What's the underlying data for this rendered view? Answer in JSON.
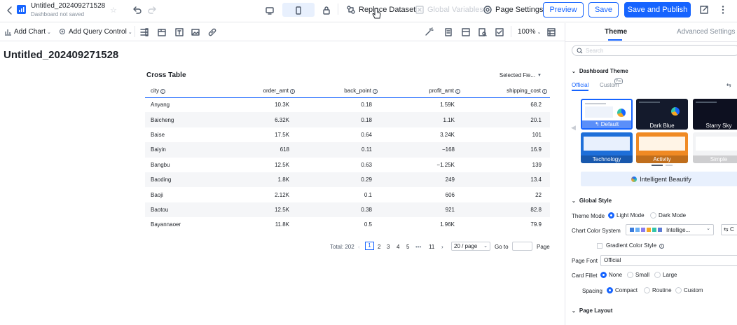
{
  "header": {
    "title": "Untitled_202409271528",
    "subtitle": "Dashboard not saved",
    "replace_dataset": "Replace Dataset",
    "global_variables": "Global Variables",
    "page_settings": "Page Settings",
    "preview": "Preview",
    "save": "Save",
    "save_publish": "Save and Publish"
  },
  "toolbar": {
    "add_chart": "Add Chart",
    "add_query_control": "Add Query Control",
    "zoom": "100%"
  },
  "canvas": {
    "dashboard_title": "Untitled_202409271528",
    "table_title": "Cross Table",
    "selected_fields": "Selected Fie...",
    "columns": [
      "city",
      "order_amt",
      "back_point",
      "profit_amt",
      "shipping_cost"
    ],
    "rows": [
      [
        "Anyang",
        "10.3K",
        "0.18",
        "1.59K",
        "68.2"
      ],
      [
        "Baicheng",
        "6.32K",
        "0.18",
        "1.1K",
        "20.1"
      ],
      [
        "Baise",
        "17.5K",
        "0.64",
        "3.24K",
        "101"
      ],
      [
        "Baiyin",
        "618",
        "0.11",
        "−168",
        "16.9"
      ],
      [
        "Bangbu",
        "12.5K",
        "0.63",
        "−1.25K",
        "139"
      ],
      [
        "Baoding",
        "1.8K",
        "0.29",
        "249",
        "13.4"
      ],
      [
        "Baoji",
        "2.12K",
        "0.1",
        "606",
        "22"
      ],
      [
        "Baotou",
        "12.5K",
        "0.38",
        "921",
        "82.8"
      ],
      [
        "Bayannaoer",
        "11.8K",
        "0.5",
        "1.96K",
        "79.9"
      ]
    ],
    "pagination": {
      "total": "Total: 202",
      "pages": [
        "1",
        "2",
        "3",
        "4",
        "5",
        "•••",
        "11"
      ],
      "page_size": "20 / page",
      "goto": "Go to",
      "page": "Page"
    }
  },
  "panel": {
    "tabs": [
      "Theme",
      "Advanced Settings"
    ],
    "search_placeholder": "Search",
    "dashboard_theme": "Dashboard Theme",
    "theme_tabs": [
      "Official",
      "Custom"
    ],
    "pro_badge": "Pro",
    "themes": [
      "Default",
      "Dark Blue",
      "Starry Sky",
      "Technology",
      "Activity",
      "Simple"
    ],
    "intelligent_beautify": "Intelligent Beautify",
    "global_style": "Global Style",
    "theme_mode_label": "Theme Mode",
    "theme_modes": [
      "Light Mode",
      "Dark Mode"
    ],
    "chart_color_label": "Chart Color System",
    "chart_color_value": "Intellige...",
    "chart_color_partial_button": "C",
    "gradient_label": "Gradient Color Style",
    "page_font_label": "Page Font",
    "page_font_value": "Official",
    "card_fillet_label": "Card Fillet",
    "card_fillet_options": [
      "None",
      "Small",
      "Large"
    ],
    "spacing_label": "Spacing",
    "spacing_options": [
      "Compact",
      "Routine",
      "Custom"
    ],
    "page_layout": "Page Layout",
    "palette": [
      "#3b7ddd",
      "#6ab0f5",
      "#8a7ef0",
      "#f5a623",
      "#35c6a9",
      "#5b7bd5"
    ]
  }
}
